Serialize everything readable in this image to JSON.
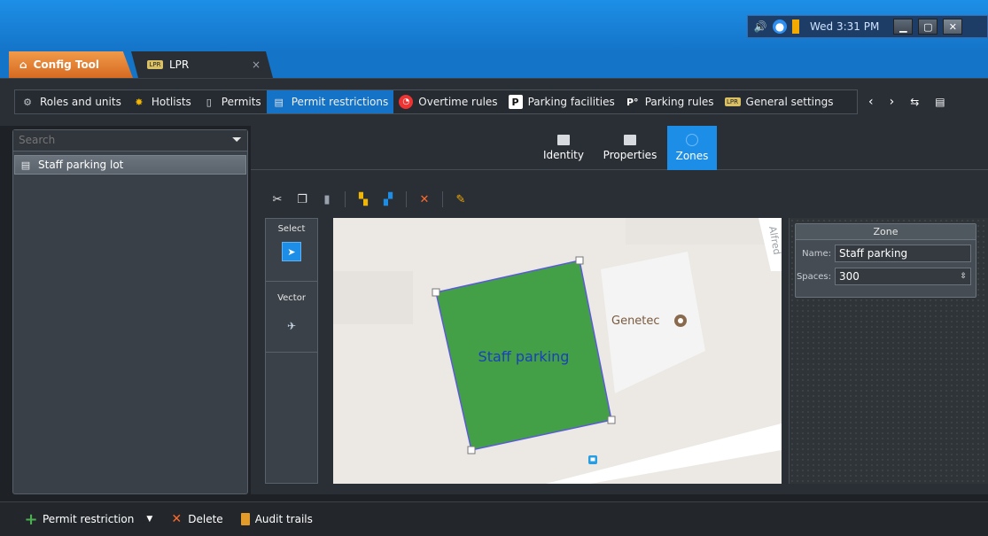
{
  "system_tray": {
    "clock": "Wed 3:31 PM"
  },
  "tabs": [
    {
      "label": "Config Tool"
    },
    {
      "label": "LPR",
      "close": "×"
    }
  ],
  "toolbar": {
    "tasks": [
      {
        "label": "Roles and units"
      },
      {
        "label": "Hotlists"
      },
      {
        "label": "Permits"
      },
      {
        "label": "Permit restrictions"
      },
      {
        "label": "Overtime rules"
      },
      {
        "label": "Parking facilities"
      },
      {
        "label": "Parking rules"
      },
      {
        "label": "General settings"
      }
    ]
  },
  "left_panel": {
    "search_placeholder": "Search",
    "entity": "Staff parking lot"
  },
  "subtabs": [
    {
      "label": "Identity"
    },
    {
      "label": "Properties"
    },
    {
      "label": "Zones"
    }
  ],
  "tools": {
    "select_label": "Select",
    "vector_label": "Vector"
  },
  "map": {
    "zone_label": "Staff parking",
    "poi_label": "Genetec",
    "street_label": "Alfred"
  },
  "zone_panel": {
    "title": "Zone",
    "name_label": "Name:",
    "name_value": "Staff parking",
    "spaces_label": "Spaces:",
    "spaces_value": "300"
  },
  "bottom_bar": {
    "add_label": "Permit restriction",
    "delete_label": "Delete",
    "audit_label": "Audit trails"
  },
  "colors": {
    "accent": "#1c8ee8",
    "zone_fill": "#43a047",
    "tab_active": "#e07a2c"
  }
}
